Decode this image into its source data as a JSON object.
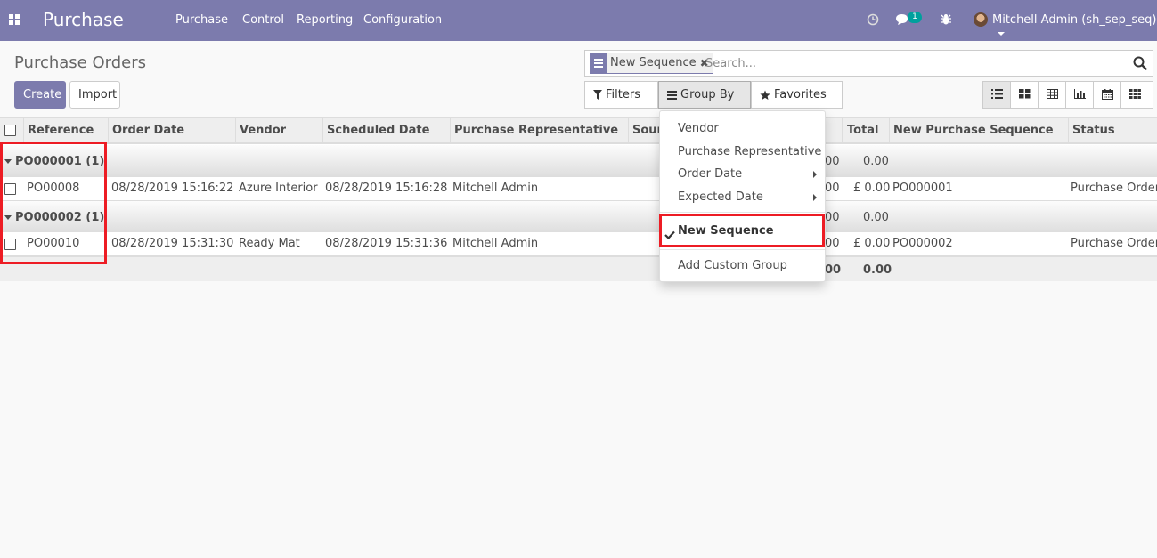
{
  "navbar": {
    "brand": "Purchase",
    "menu": [
      "Purchase",
      "Control",
      "Reporting",
      "Configuration"
    ],
    "messages_count": "1",
    "user": "Mitchell Admin (sh_sep_seq)",
    "bg_color": "#7c7bad"
  },
  "control_panel": {
    "title": "Purchase Orders",
    "create_label": "Create",
    "import_label": "Import",
    "facet_value": "New Sequence",
    "facet_close": "✖",
    "search_placeholder": "Search...",
    "filters_label": "Filters",
    "group_by_label": "Group By",
    "favorites_label": "Favorites"
  },
  "views": [
    "list-view-icon",
    "kanban-view-icon",
    "pivot-view-icon",
    "graph-view-icon",
    "calendar-view-icon",
    "grid-view-icon"
  ],
  "table": {
    "columns": [
      "Reference",
      "Order Date",
      "Vendor",
      "Scheduled Date",
      "Purchase Representative",
      "Sour",
      "Total",
      "New Purchase Sequence",
      "Status"
    ],
    "groups": [
      {
        "label": "PO000001 (1)",
        "untaxed_partial": "00",
        "total": "0.00",
        "rows": [
          {
            "reference": "PO00008",
            "order_date": "08/28/2019 15:16:22",
            "vendor": "Azure Interior",
            "scheduled_date": "08/28/2019 15:16:28",
            "rep": "Mitchell Admin",
            "untaxed_partial": "00",
            "total": "£ 0.00",
            "sequence": "PO000001",
            "status": "Purchase Order"
          }
        ]
      },
      {
        "label": "PO000002 (1)",
        "untaxed_partial": "00",
        "total": "0.00",
        "rows": [
          {
            "reference": "PO00010",
            "order_date": "08/28/2019 15:31:30",
            "vendor": "Ready Mat",
            "scheduled_date": "08/28/2019 15:31:36",
            "rep": "Mitchell Admin",
            "untaxed_partial": "00",
            "total": "£ 0.00",
            "sequence": "PO000002",
            "status": "Purchase Order"
          }
        ]
      }
    ],
    "footer": {
      "untaxed_partial": "00",
      "total": "0.00"
    }
  },
  "group_by_menu": {
    "items": [
      "Vendor",
      "Purchase Representative",
      "Order Date",
      "Expected Date"
    ],
    "selected": "New Sequence",
    "custom": "Add Custom Group"
  },
  "colors": {
    "highlight": "#ed1c24",
    "accent": "#7c7bad"
  }
}
